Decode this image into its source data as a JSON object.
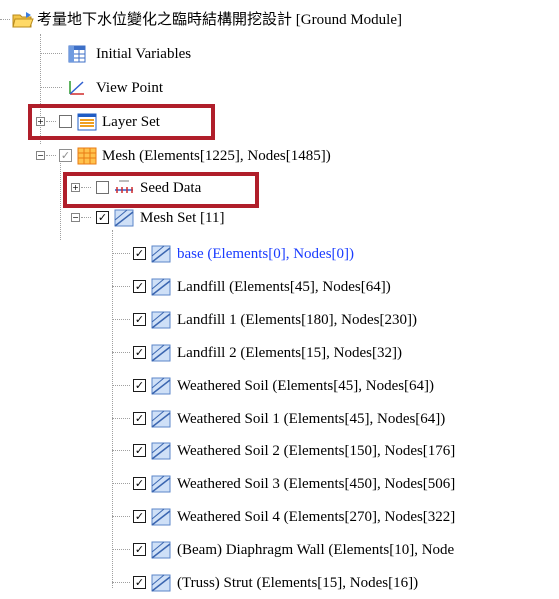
{
  "tree": {
    "root": {
      "label": "考量地下水位變化之臨時結構開挖設計 [Ground Module]"
    },
    "initial_variables": {
      "label": "Initial Variables"
    },
    "view_point": {
      "label": "View Point"
    },
    "layer_set": {
      "label": "Layer Set"
    },
    "mesh": {
      "label": "Mesh (Elements[1225], Nodes[1485])"
    },
    "seed_data": {
      "label": "Seed Data"
    },
    "mesh_set": {
      "label": "Mesh Set [11]"
    },
    "mesh_items": [
      {
        "label": "base (Elements[0], Nodes[0])",
        "selected": true
      },
      {
        "label": "Landfill (Elements[45], Nodes[64])"
      },
      {
        "label": "Landfill 1 (Elements[180], Nodes[230])"
      },
      {
        "label": "Landfill 2 (Elements[15], Nodes[32])"
      },
      {
        "label": "Weathered Soil (Elements[45], Nodes[64])"
      },
      {
        "label": "Weathered Soil 1 (Elements[45], Nodes[64])"
      },
      {
        "label": "Weathered Soil 2 (Elements[150], Nodes[176]"
      },
      {
        "label": "Weathered Soil 3 (Elements[450], Nodes[506]"
      },
      {
        "label": "Weathered Soil 4 (Elements[270], Nodes[322]"
      },
      {
        "label": "(Beam) Diaphragm Wall (Elements[10], Node"
      },
      {
        "label": "(Truss) Strut (Elements[15], Nodes[16])"
      }
    ]
  },
  "colors": {
    "highlight_box": "#b01e2a",
    "selected_text": "#1a3cff"
  }
}
